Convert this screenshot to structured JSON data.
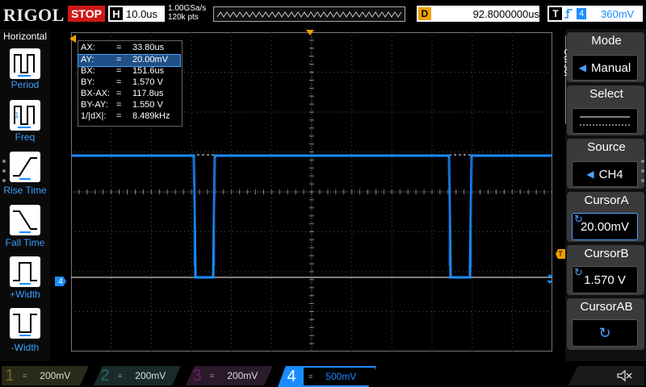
{
  "brand": "RIGOL",
  "run_state": "STOP",
  "horizontal": {
    "label": "H",
    "timebase": "10.0us",
    "sample_rate": "1.00GSa/s",
    "points": "120k pts"
  },
  "delay": {
    "label": "D",
    "value": "92.8000000us"
  },
  "trigger": {
    "label": "T",
    "channel": "4",
    "level": "360mV"
  },
  "left_menu": {
    "title": "Horizontal",
    "items": [
      {
        "label": "Period",
        "icon": "period-icon"
      },
      {
        "label": "Freq",
        "icon": "freq-icon"
      },
      {
        "label": "Rise Time",
        "icon": "rise-time-icon"
      },
      {
        "label": "Fall Time",
        "icon": "fall-time-icon"
      },
      {
        "label": "+Width",
        "icon": "plus-width-icon"
      },
      {
        "label": "-Width",
        "icon": "minus-width-icon"
      }
    ]
  },
  "cursor_info": {
    "rows": [
      {
        "key": "AX:",
        "eq": "=",
        "value": "33.80us",
        "selected": false
      },
      {
        "key": "AY:",
        "eq": "=",
        "value": "20.00mV",
        "selected": true
      },
      {
        "key": "BX:",
        "eq": "=",
        "value": "151.6us",
        "selected": false
      },
      {
        "key": "BY:",
        "eq": "=",
        "value": "1.570 V",
        "selected": false
      },
      {
        "key": "BX-AX:",
        "eq": "=",
        "value": "117.8us",
        "selected": false
      },
      {
        "key": "BY-AY:",
        "eq": "=",
        "value": "1.550 V",
        "selected": false
      },
      {
        "key": "1/|dX|:",
        "eq": "=",
        "value": "8.489kHz",
        "selected": false
      }
    ]
  },
  "right_menu": {
    "vertical_title": "Cursor",
    "mode": {
      "title": "Mode",
      "value": "Manual"
    },
    "select": {
      "title": "Select"
    },
    "source": {
      "title": "Source",
      "value": "CH4"
    },
    "cursor_a": {
      "title": "CursorA",
      "value": "20.00mV"
    },
    "cursor_b": {
      "title": "CursorB",
      "value": "1.570 V"
    },
    "cursor_ab": {
      "title": "CursorAB"
    }
  },
  "channels": [
    {
      "num": "1",
      "scale": "200mV",
      "color": "#a0a000",
      "active": false
    },
    {
      "num": "2",
      "scale": "200mV",
      "color": "#00a0a0",
      "active": false
    },
    {
      "num": "3",
      "scale": "200mV",
      "color": "#a000a0",
      "active": false
    },
    {
      "num": "4",
      "scale": "500mV",
      "color": "#1a8cff",
      "active": true
    }
  ],
  "markers": {
    "ch4_ground": "4",
    "trigger_level": "T"
  },
  "colors": {
    "ch4": "#1a8cff",
    "trigger": "#f0a000",
    "stop": "#d01818"
  }
}
